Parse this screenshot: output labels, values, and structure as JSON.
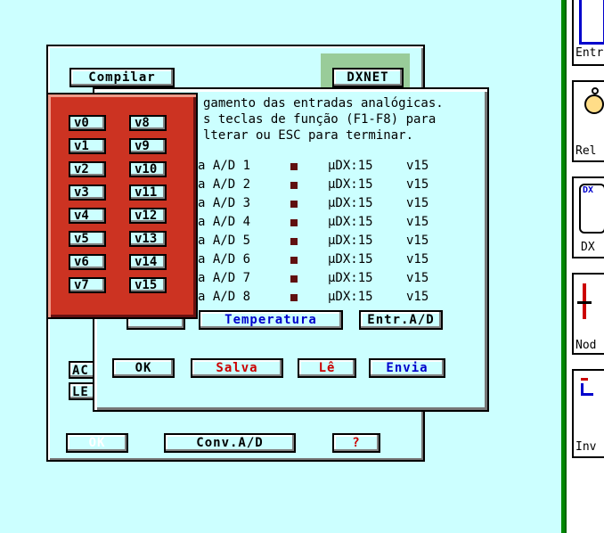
{
  "main_dialog": {
    "compile_button": "Compilar",
    "dxnet_label": "DXNET",
    "ok_button": "OK",
    "conv_button": "Conv.A/D",
    "help_button": "?",
    "partial_ac": "AC",
    "partial_le": "LE"
  },
  "analog_dialog": {
    "line1": "gamento das entradas analógicas.",
    "line2": "s teclas de função (F1-F8) para",
    "line3": "lterar ou ESC para terminar.",
    "rows": [
      {
        "label": "a A/D 1",
        "module": "µDX:15",
        "var": "v15"
      },
      {
        "label": "a A/D 2",
        "module": "µDX:15",
        "var": "v15"
      },
      {
        "label": "a A/D 3",
        "module": "µDX:15",
        "var": "v15"
      },
      {
        "label": "a A/D 4",
        "module": "µDX:15",
        "var": "v15"
      },
      {
        "label": "a A/D 5",
        "module": "µDX:15",
        "var": "v15"
      },
      {
        "label": "a A/D 6",
        "module": "µDX:15",
        "var": "v15"
      },
      {
        "label": "a A/D 7",
        "module": "µDX:15",
        "var": "v15"
      },
      {
        "label": "a A/D 8",
        "module": "µDX:15",
        "var": "v15"
      }
    ],
    "temperatura_button": "Temperatura",
    "entr_ad_button": "Entr.A/D",
    "ok_button": "OK",
    "salva_button": "Salva",
    "le_button": "Lê",
    "envia_button": "Envia"
  },
  "var_picker": {
    "left": [
      "v0",
      "v1",
      "v2",
      "v3",
      "v4",
      "v5",
      "v6",
      "v7"
    ],
    "right": [
      "v8",
      "v9",
      "v10",
      "v11",
      "v12",
      "v13",
      "v14",
      "v15"
    ]
  },
  "right_panel": {
    "items": [
      "Entr",
      "Rel",
      "DX",
      "Nod",
      "Inv"
    ],
    "dx_icon_label": "DX"
  },
  "colors": {
    "background": "#ccffff",
    "picker_red": "#cc3322",
    "dxnet_green": "#99cc99",
    "blue_text": "#0000cc",
    "red_text": "#cc0000"
  }
}
